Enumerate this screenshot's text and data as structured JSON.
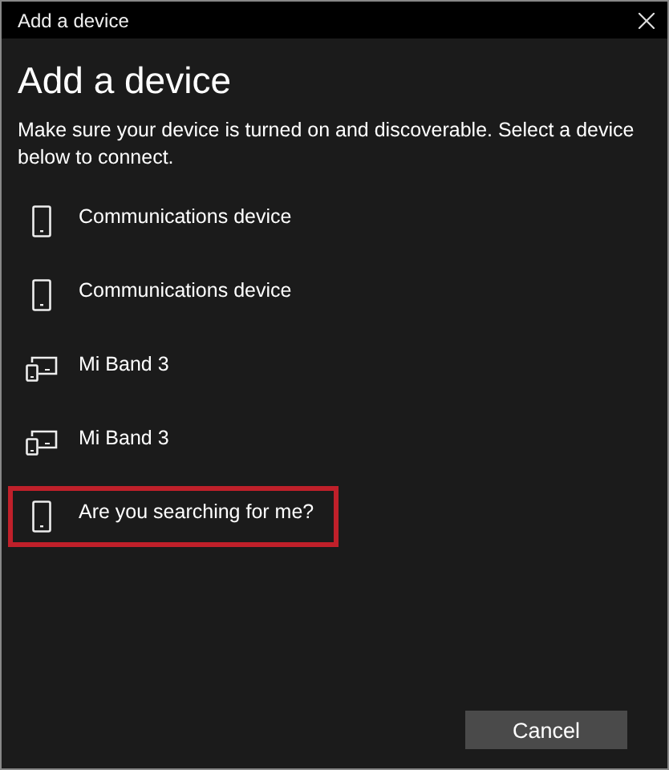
{
  "window": {
    "title": "Add a device"
  },
  "heading": "Add a device",
  "description": "Make sure your device is turned on and discoverable. Select a device below to connect.",
  "devices": [
    {
      "name": "Communications device",
      "kind": "phone",
      "highlighted": false
    },
    {
      "name": "Communications device",
      "kind": "phone",
      "highlighted": false
    },
    {
      "name": "Mi Band 3",
      "kind": "devices",
      "highlighted": false
    },
    {
      "name": "Mi Band 3",
      "kind": "devices",
      "highlighted": false
    },
    {
      "name": "Are you searching for me?",
      "kind": "phone",
      "highlighted": true
    }
  ],
  "buttons": [
    "Cancel"
  ]
}
